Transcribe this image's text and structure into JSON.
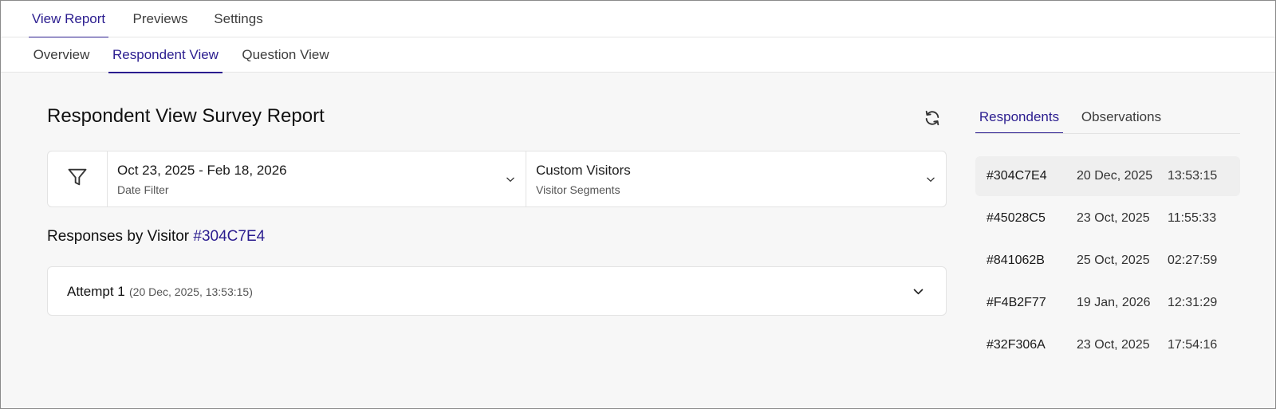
{
  "top_tabs": [
    {
      "label": "View Report",
      "active": true
    },
    {
      "label": "Previews",
      "active": false
    },
    {
      "label": "Settings",
      "active": false
    }
  ],
  "sub_tabs": [
    {
      "label": "Overview",
      "active": false
    },
    {
      "label": "Respondent View",
      "active": true
    },
    {
      "label": "Question View",
      "active": false
    }
  ],
  "page_title": "Respondent View Survey Report",
  "filters": {
    "date": {
      "value": "Oct 23, 2025 - Feb 18, 2026",
      "label": "Date Filter"
    },
    "segment": {
      "value": "Custom Visitors",
      "label": "Visitor Segments"
    }
  },
  "responses": {
    "heading_prefix": "Responses by Visitor",
    "visitor_id": "#304C7E4"
  },
  "attempt": {
    "label": "Attempt 1",
    "meta": "(20 Dec, 2025, 13:53:15)"
  },
  "right_panel": {
    "tabs": [
      {
        "label": "Respondents",
        "active": true
      },
      {
        "label": "Observations",
        "active": false
      }
    ],
    "respondents": [
      {
        "id": "#304C7E4",
        "date": "20 Dec, 2025",
        "time": "13:53:15",
        "selected": true
      },
      {
        "id": "#45028C5",
        "date": "23 Oct, 2025",
        "time": "11:55:33",
        "selected": false
      },
      {
        "id": "#841062B",
        "date": "25 Oct, 2025",
        "time": "02:27:59",
        "selected": false
      },
      {
        "id": "#F4B2F77",
        "date": "19 Jan, 2026",
        "time": "12:31:29",
        "selected": false
      },
      {
        "id": "#32F306A",
        "date": "23 Oct, 2025",
        "time": "17:54:16",
        "selected": false
      }
    ]
  },
  "colors": {
    "accent": "#2b1d8f",
    "background": "#f7f7f7",
    "card": "#ffffff"
  }
}
